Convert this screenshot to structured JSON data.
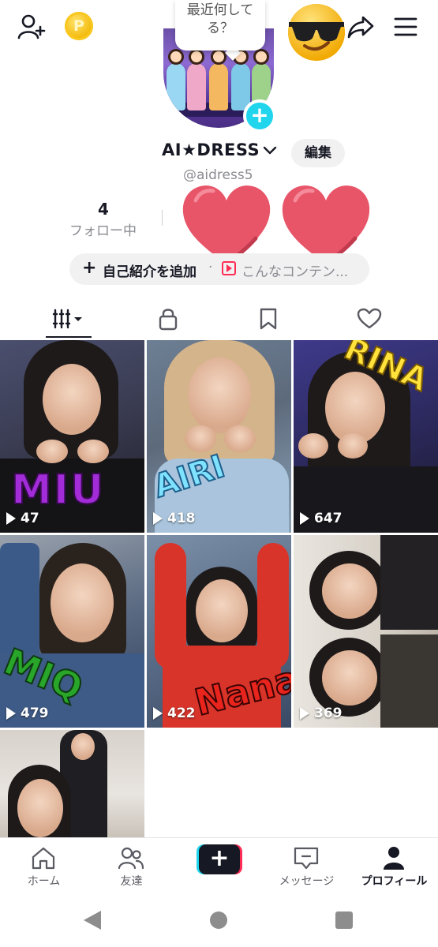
{
  "header": {
    "bubble_text": "最近何してる？",
    "coin_symbol": "P"
  },
  "profile": {
    "username": "AI★DRESS",
    "handle": "@aidress5",
    "edit_label": "編集",
    "stats": {
      "following_count": "4",
      "following_label": "フォロー中"
    },
    "bio": {
      "add_label": "自己紹介を追加",
      "separator": "·",
      "suggestion": "こんなコンテン..."
    }
  },
  "tabs": [
    "videos",
    "private",
    "saved",
    "liked"
  ],
  "videos": [
    {
      "views": "47",
      "name_art": "MIU"
    },
    {
      "views": "418",
      "name_art": "AIRI"
    },
    {
      "views": "647",
      "name_art": "RINA"
    },
    {
      "views": "479",
      "name_art": "MIQ"
    },
    {
      "views": "422",
      "name_art": "Nana"
    },
    {
      "views": "369",
      "name_art": ""
    },
    {
      "views": "",
      "name_art": ""
    }
  ],
  "bottom_nav": {
    "home": "ホーム",
    "friends": "友達",
    "create": "+",
    "inbox": "メッセージ",
    "profile": "プロフィール"
  },
  "colors": {
    "accent_cyan": "#20d5ec",
    "accent_red": "#fe2c55",
    "heart": "#e85468",
    "text": "#161823",
    "muted": "#8a8b91"
  }
}
